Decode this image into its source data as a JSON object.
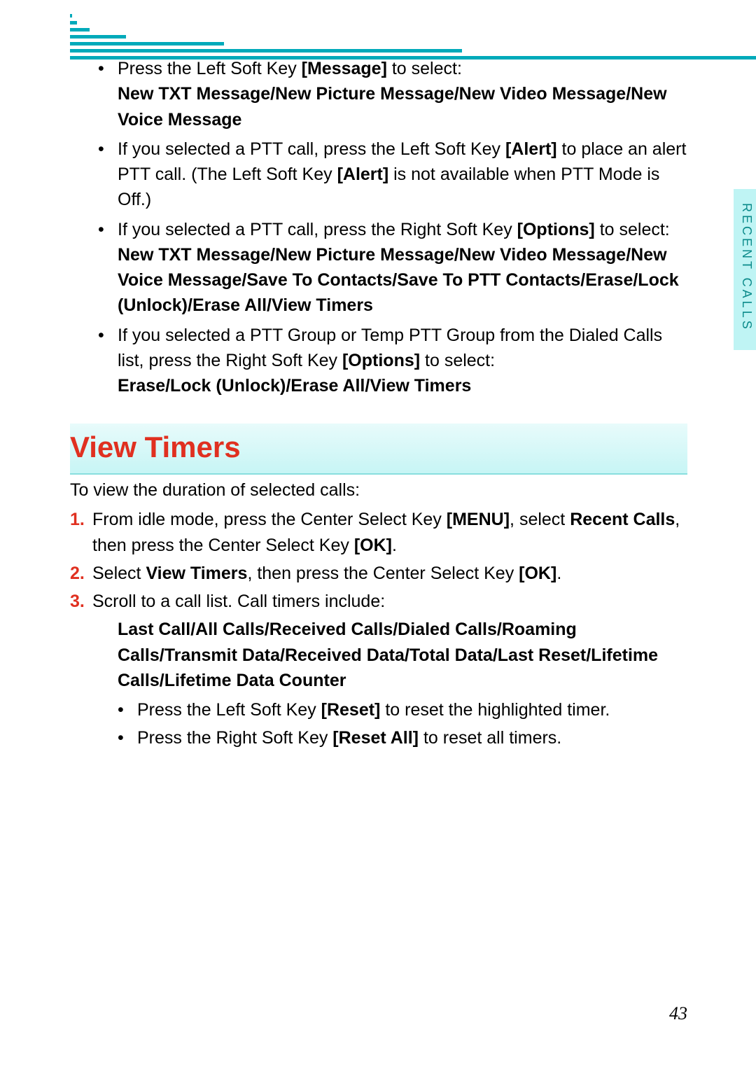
{
  "sidetab": "RECENT CALLS",
  "page_number": "43",
  "top_bullets": [
    {
      "prefix": "Press the Left Soft Key ",
      "bold1": "[Message]",
      "mid": " to select:",
      "line2_bold": "New TXT Message/New Picture Message/New Video Message/New Voice Message"
    },
    {
      "prefix": "If you selected a PTT call, press the Left Soft Key ",
      "bold1": "[Alert]",
      "mid": " to place an alert PTT call. (The Left Soft Key ",
      "bold2": "[Alert]",
      "tail": " is not available when PTT Mode is Off.)"
    },
    {
      "prefix": "If you selected a PTT call, press the Right Soft Key ",
      "bold1": "[Options]",
      "mid": " to select:",
      "line2_bold": "New TXT Message/New Picture Message/New Video Message/New Voice Message/Save To Contacts/Save To PTT Contacts/Erase/Lock (Unlock)/Erase All/View Timers"
    },
    {
      "prefix": "If you selected a PTT Group or Temp PTT Group from the Dialed Calls list, press the Right Soft Key ",
      "bold1": "[Options]",
      "mid": " to select:",
      "line2_bold": "Erase/Lock (Unlock)/Erase All/View Timers"
    }
  ],
  "section_heading": "View Timers",
  "lead": "To view the duration of selected calls:",
  "steps": [
    {
      "num": "1.",
      "t1": "From idle mode, press the Center Select Key ",
      "b1": "[MENU]",
      "t2": ", select ",
      "b2": "Recent Calls",
      "t3": ", then press the Center Select Key ",
      "b3": "[OK]",
      "t4": "."
    },
    {
      "num": "2.",
      "t1": "Select ",
      "b1": "View Timers",
      "t2": ", then press the Center Select Key ",
      "b2": "[OK]",
      "t3": "."
    },
    {
      "num": "3.",
      "t1": "Scroll to a call list. Call timers include:"
    }
  ],
  "step3_bold": "Last Call/All Calls/Received Calls/Dialed Calls/Roaming Calls/Transmit Data/Received Data/Total Data/Last Reset/Lifetime Calls/Lifetime Data Counter",
  "step3_sub": [
    {
      "t1": "Press the Left Soft Key ",
      "b1": "[Reset]",
      "t2": " to reset the highlighted timer."
    },
    {
      "t1": "Press the Right Soft Key ",
      "b1": "[Reset All]",
      "t2": " to reset all timers."
    }
  ]
}
